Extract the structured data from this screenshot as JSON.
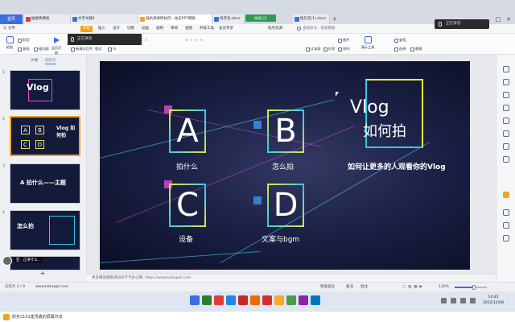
{
  "tabs": {
    "home": "首页",
    "docs": [
      {
        "label": "柏图秀模板",
        "color": "#e23b3b"
      },
      {
        "label": "文字文稿1",
        "color": "#3b6ee3"
      },
      {
        "label": "抵抗演讲所抗风...动态PPT模板",
        "color": "#f0a223",
        "active": true
      },
      {
        "label": "经济合.docx",
        "color": "#3b6ee3"
      },
      {
        "label": "给历史(1).docx",
        "color": "#3b6ee3"
      }
    ],
    "green_chip": "视频已开",
    "speaking": "正在讲话:",
    "add": "+",
    "min": "–",
    "max": "□",
    "close": "×"
  },
  "menubar": {
    "items": [
      "三 文件",
      "开始",
      "插入",
      "设计",
      "切换",
      "动画",
      "放映",
      "审阅",
      "视图",
      "开发工具",
      "会员专享",
      "稻壳资源"
    ],
    "active_item": "开始",
    "search": "查找命令、搜索模板",
    "popup": "正在讲话:"
  },
  "ribbon": {
    "row1": [
      "剪切",
      "格式刷",
      "新建幻灯片",
      "版式",
      "重置",
      "节"
    ],
    "row2": [
      "粘贴",
      "复制",
      "当页开始"
    ],
    "right": [
      "文本框",
      "形状",
      "排列",
      "图片",
      "演示工具",
      "查找",
      "替换",
      "选择"
    ],
    "play": "当页开始"
  },
  "leftpanel": {
    "tabs": [
      "大纲",
      "幻灯片"
    ],
    "active_tab": "幻灯片",
    "thumbs": [
      {
        "num": "1",
        "title": "Vlog"
      },
      {
        "num": "2",
        "title": "Vlog 如何拍"
      },
      {
        "num": "3",
        "title": "A  拍什么——主题"
      },
      {
        "num": "4",
        "title": "怎么拍"
      }
    ],
    "camera_label": "亚...正讲什么...",
    "add": "+"
  },
  "slide": {
    "items": [
      {
        "letter": "A",
        "label": "拍什么"
      },
      {
        "letter": "B",
        "label": "怎么拍"
      },
      {
        "letter": "C",
        "label": "设备"
      },
      {
        "letter": "D",
        "label": "文案与bgm"
      }
    ],
    "title_en": "Vlog",
    "title_cn": "如何拍",
    "subtitle": "如何让更多的人观看你的Vlog"
  },
  "notes": "更多精美模板请访问卡卡办公网: https://www.kakappt.com",
  "status": {
    "slide_info": "幻灯片 2 / 9",
    "site": "www.kakappt.com",
    "beautify": "智能美化",
    "notes_btn": "备注",
    "comment_btn": "批注",
    "zoom": "120%",
    "zoom_fraction": 0.6
  },
  "taskbar": {
    "time": "14:45",
    "date": "2022/12/08",
    "apps": [
      "#3b6ee3",
      "#2e7d32",
      "#e23b3b",
      "#1e88e5",
      "#c62828",
      "#ef6c00",
      "#d32f2f",
      "#f9a825",
      "#43a047",
      "#8e24aa",
      "#0277bd"
    ]
  },
  "sharebar": {
    "text": "财务2101崔员鑫的屏幕共享"
  },
  "colors": {
    "accent": "#3b6ee3",
    "orange": "#f0a223",
    "yellow": "#e8e83a",
    "cyan": "#35c6ea",
    "magenta": "#e14cd0"
  }
}
